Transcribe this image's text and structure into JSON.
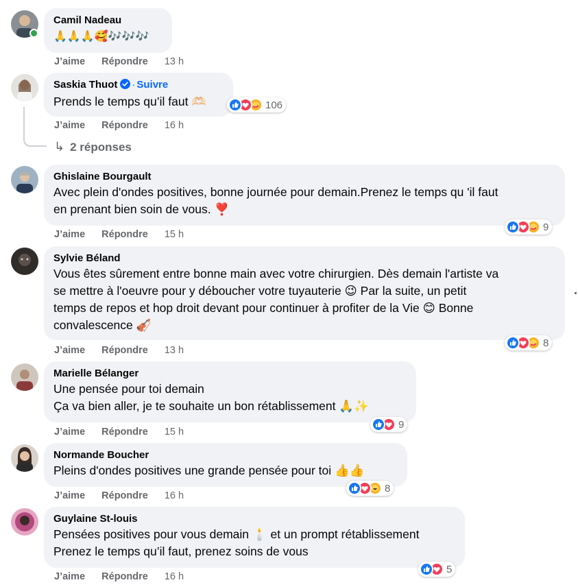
{
  "colors": {
    "bubble": "#f0f2f5",
    "link_blue": "#0866ff",
    "meta_gray": "#65676b",
    "like_blue": "#1877f2",
    "love_red": "#f33e58",
    "care_yellow": "#f7b125",
    "online_green": "#31a24c"
  },
  "actions": {
    "like": "J’aime",
    "reply": "Répondre"
  },
  "comments": [
    {
      "author": "Camil Nadeau",
      "lines": [
        "🙏🙏🙏🥰🎶🎶🎶"
      ],
      "time": "13 h",
      "online": true
    },
    {
      "author": "Saskia Thuot",
      "verified": true,
      "separator": "·",
      "follow": "Suivre",
      "lines": [
        "Prends le temps qu’il faut 🫶🏻"
      ],
      "time": "16 h",
      "reactions": {
        "icons": [
          "like-icon",
          "love-icon",
          "care-icon"
        ],
        "count": "106"
      },
      "replies": "2 réponses"
    },
    {
      "author": "Ghislaine Bourgault",
      "lines": [
        "Avec plein d'ondes positives, bonne journée pour demain.Prenez le temps qu 'il faut",
        "en prenant bien soin de vous. ❣️"
      ],
      "time": "15 h",
      "reactions": {
        "icons": [
          "like-icon",
          "love-icon",
          "care-icon"
        ],
        "count": "9"
      }
    },
    {
      "author": "Sylvie Béland",
      "lines": [
        "Vous êtes sûrement entre bonne main avec votre chirurgien. Dès demain l'artiste va",
        "se mettre à l'oeuvre pour y déboucher votre tuyauterie 😉 Par la suite, un petit",
        "temps de repos et hop droit devant pour continuer à profiter de la Vie 😊 Bonne",
        "convalescence 🎻"
      ],
      "time": "13 h",
      "reactions": {
        "icons": [
          "like-icon",
          "love-icon",
          "care-icon"
        ],
        "count": "8"
      }
    },
    {
      "author": "Marielle Bélanger",
      "lines": [
        "Une pensée pour toi demain",
        "Ça va bien aller, je te souhaite un bon rétablissement 🙏✨"
      ],
      "time": "15 h",
      "reactions": {
        "icons": [
          "like-icon",
          "love-icon"
        ],
        "count": "9"
      }
    },
    {
      "author": "Normande Boucher",
      "lines": [
        "Pleins d'ondes positives une grande pensée pour toi 👍👍"
      ],
      "time": "16 h",
      "reactions": {
        "icons": [
          "like-icon",
          "love-icon",
          "haha-icon"
        ],
        "count": "8"
      }
    },
    {
      "author": "Guylaine St-louis",
      "lines": [
        "Pensées positives pour vous demain 🕯️ et un prompt rétablissement",
        "Prenez le temps qu’il faut, prenez soins de vous"
      ],
      "time": "16 h",
      "reactions": {
        "icons": [
          "like-icon",
          "love-icon"
        ],
        "count": "5"
      }
    }
  ]
}
